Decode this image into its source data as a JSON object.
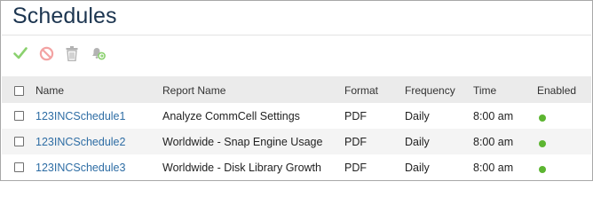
{
  "page": {
    "title": "Schedules"
  },
  "toolbar": {
    "icons": [
      "enable-check-icon",
      "disable-circle-icon",
      "delete-trash-icon",
      "notify-bell-icon"
    ]
  },
  "table": {
    "headers": {
      "name": "Name",
      "report": "Report Name",
      "format": "Format",
      "frequency": "Frequency",
      "time": "Time",
      "enabled": "Enabled"
    },
    "rows": [
      {
        "name": "123INCSchedule1",
        "report": "Analyze CommCell Settings",
        "format": "PDF",
        "frequency": "Daily",
        "time": "8:00 am",
        "enabled": true
      },
      {
        "name": "123INCSchedule2",
        "report": "Worldwide - Snap Engine Usage",
        "format": "PDF",
        "frequency": "Daily",
        "time": "8:00 am",
        "enabled": true
      },
      {
        "name": "123INCSchedule3",
        "report": "Worldwide - Disk Library Growth",
        "format": "PDF",
        "frequency": "Daily",
        "time": "8:00 am",
        "enabled": true
      }
    ]
  },
  "colors": {
    "title": "#1c3550",
    "link": "#2e6da4",
    "enabled_dot": "#5cb531",
    "check_icon": "#8bd16f",
    "disable_icon": "#f3a3a3",
    "gray_icon": "#b3b3b3"
  }
}
